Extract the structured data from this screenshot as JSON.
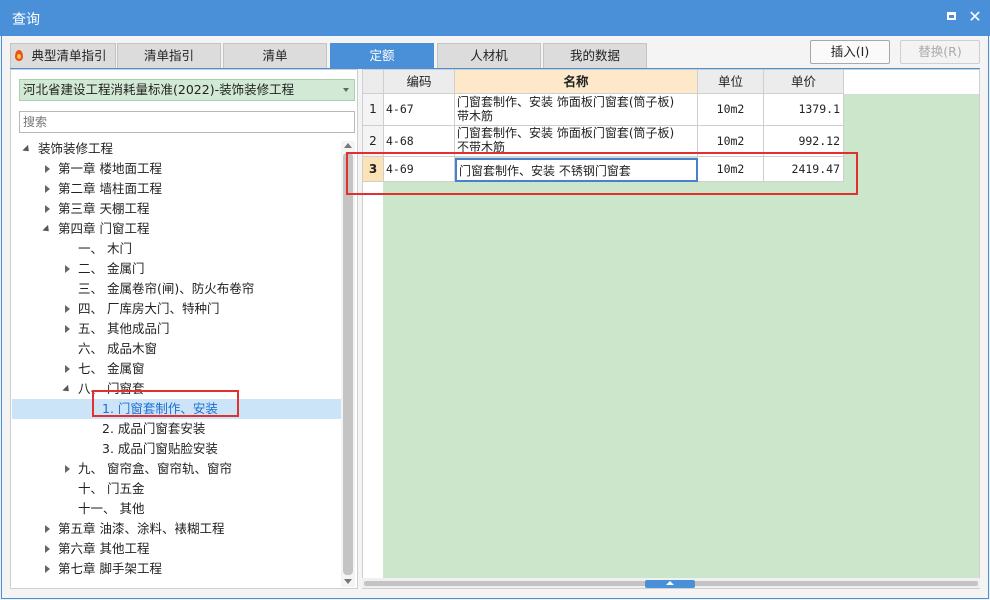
{
  "window": {
    "title": "查询"
  },
  "tabs": [
    {
      "label": "典型清单指引",
      "active": false
    },
    {
      "label": "清单指引",
      "active": false
    },
    {
      "label": "清单",
      "active": false
    },
    {
      "label": "定额",
      "active": true
    },
    {
      "label": "人材机",
      "active": false
    },
    {
      "label": "我的数据",
      "active": false
    }
  ],
  "buttons": {
    "insert": "插入(I)",
    "replace": "替换(R)"
  },
  "left": {
    "standard": "河北省建设工程消耗量标准(2022)-装饰装修工程",
    "search_placeholder": "搜索",
    "tree": [
      {
        "label": "装饰装修工程",
        "toggle": "open",
        "level": 0
      },
      {
        "label": "第一章 楼地面工程",
        "toggle": "closed",
        "level": 1
      },
      {
        "label": "第二章 墙柱面工程",
        "toggle": "closed",
        "level": 1
      },
      {
        "label": "第三章 天棚工程",
        "toggle": "closed",
        "level": 1
      },
      {
        "label": "第四章 门窗工程",
        "toggle": "open",
        "level": 1
      },
      {
        "label": "一、 木门",
        "toggle": "none",
        "level": 2
      },
      {
        "label": "二、 金属门",
        "toggle": "closed",
        "level": 2
      },
      {
        "label": "三、 金属卷帘(闸)、防火布卷帘",
        "toggle": "none",
        "level": 2
      },
      {
        "label": "四、 厂库房大门、特种门",
        "toggle": "closed",
        "level": 2
      },
      {
        "label": "五、 其他成品门",
        "toggle": "closed",
        "level": 2
      },
      {
        "label": "六、 成品木窗",
        "toggle": "none",
        "level": 2
      },
      {
        "label": "七、 金属窗",
        "toggle": "closed",
        "level": 2
      },
      {
        "label": "八、 门窗套",
        "toggle": "open",
        "level": 2
      },
      {
        "label": "1. 门窗套制作、安装",
        "toggle": "none",
        "level": 3,
        "selected": true
      },
      {
        "label": "2. 成品门窗套安装",
        "toggle": "none",
        "level": 3
      },
      {
        "label": "3. 成品门窗贴脸安装",
        "toggle": "none",
        "level": 3
      },
      {
        "label": "九、 窗帘盒、窗帘轨、窗帘",
        "toggle": "closed",
        "level": 2
      },
      {
        "label": "十、 门五金",
        "toggle": "none",
        "level": 2
      },
      {
        "label": "十一、 其他",
        "toggle": "none",
        "level": 2
      },
      {
        "label": "第五章 油漆、涂料、裱糊工程",
        "toggle": "closed",
        "level": 1
      },
      {
        "label": "第六章 其他工程",
        "toggle": "closed",
        "level": 1
      },
      {
        "label": "第七章 脚手架工程",
        "toggle": "closed",
        "level": 1
      }
    ]
  },
  "grid": {
    "columns": {
      "code": "编码",
      "name": "名称",
      "unit": "单位",
      "price": "单价"
    },
    "rows": [
      {
        "no": "1",
        "code": "4-67",
        "name_line1": "门窗套制作、安装 饰面板门窗套(筒子板)",
        "name_line2": "带木筋",
        "unit": "10m2",
        "price": "1379.1"
      },
      {
        "no": "2",
        "code": "4-68",
        "name_line1": "门窗套制作、安装 饰面板门窗套(筒子板)",
        "name_line2": "不带木筋",
        "unit": "10m2",
        "price": "992.12"
      },
      {
        "no": "3",
        "code": "4-69",
        "name_line1": "门窗套制作、安装 不锈钢门窗套",
        "name_line2": "",
        "unit": "10m2",
        "price": "2419.47"
      }
    ]
  },
  "colors": {
    "accent": "#4a90d9",
    "grid_bg": "#cce6cc",
    "header_highlight": "#fde9c9",
    "annotation": "#e03030"
  }
}
